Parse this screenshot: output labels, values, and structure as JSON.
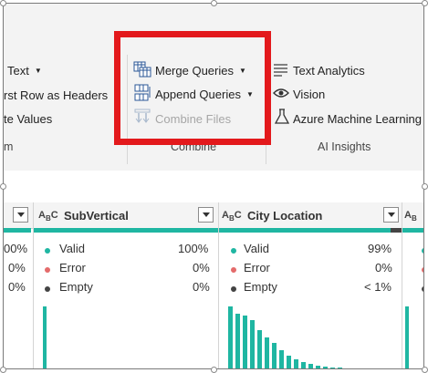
{
  "ribbon": {
    "transform_group": {
      "text_label": "Text",
      "first_row_label": "rst Row as Headers",
      "values_label": "te Values",
      "group_label": "m"
    },
    "combine_group": {
      "merge_label": "Merge Queries",
      "append_label": "Append Queries",
      "combine_files_label": "Combine Files",
      "group_label": "Combine"
    },
    "ai_group": {
      "text_analytics_label": "Text Analytics",
      "vision_label": "Vision",
      "azure_ml_label": "Azure Machine Learning",
      "group_label": "AI Insights"
    }
  },
  "columns": {
    "left_partial": {
      "valid_pct": "00%",
      "error_pct": "0%",
      "empty_pct": "0%"
    },
    "subvertical": {
      "name": "SubVertical",
      "type_glyph": "A",
      "type_sub": "B",
      "type_c": "C",
      "valid_label": "Valid",
      "valid_pct": "100%",
      "error_label": "Error",
      "error_pct": "0%",
      "empty_label": "Empty",
      "empty_pct": "0%"
    },
    "city_location": {
      "name": "City Location",
      "type_glyph": "A",
      "type_sub": "B",
      "type_c": "C",
      "valid_label": "Valid",
      "valid_pct": "99%",
      "error_label": "Error",
      "error_pct": "0%",
      "empty_label": "Empty",
      "empty_pct": "< 1%"
    }
  },
  "colors": {
    "valid": "#1fb6a2",
    "error": "#e46b6b",
    "empty": "#444444",
    "highlight": "#e3191c"
  }
}
